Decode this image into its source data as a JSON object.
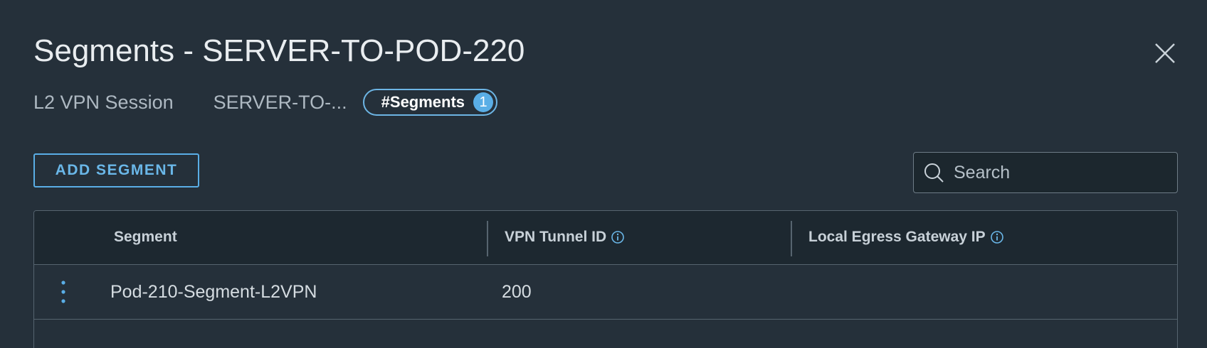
{
  "dialog": {
    "title": "Segments - SERVER-TO-POD-220",
    "close_icon": "close-icon"
  },
  "meta": {
    "session_label": "L2 VPN Session",
    "session_value": "SERVER-TO-...",
    "chip_label": "#Segments",
    "chip_count": "1"
  },
  "toolbar": {
    "add_label": "ADD SEGMENT",
    "search_placeholder": "Search",
    "search_value": "",
    "search_icon": "search-icon"
  },
  "grid": {
    "columns": [
      {
        "label": "Segment",
        "info": false
      },
      {
        "label": "VPN Tunnel ID",
        "info": true
      },
      {
        "label": "Local Egress Gateway IP",
        "info": true
      }
    ],
    "rows": [
      {
        "segment": "Pod-210-Segment-L2VPN",
        "tunnel_id": "200",
        "egress_ip": ""
      }
    ]
  },
  "colors": {
    "background": "#25303a",
    "accent": "#5aaee6",
    "header_background": "#1d2830"
  }
}
